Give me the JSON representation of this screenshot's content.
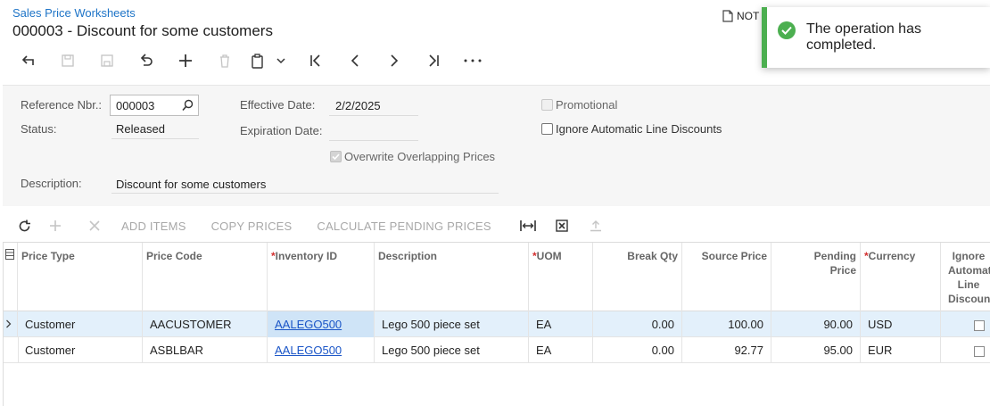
{
  "header": {
    "breadcrumb": "Sales Price Worksheets",
    "title": "000003 - Discount for some customers",
    "notes_label": "NOT"
  },
  "toast": {
    "message": "The operation has completed.",
    "color": "#4caf50"
  },
  "form": {
    "reference_label": "Reference Nbr.:",
    "reference_value": "000003",
    "status_label": "Status:",
    "status_value": "Released",
    "effective_label": "Effective Date:",
    "effective_value": "2/2/2025",
    "expiration_label": "Expiration Date:",
    "expiration_value": "",
    "promotional_label": "Promotional",
    "promotional_checked": false,
    "ignore_auto_label": "Ignore Automatic Line Discounts",
    "ignore_auto_checked": false,
    "overwrite_label": "Overwrite Overlapping Prices",
    "overwrite_checked": true,
    "description_label": "Description:",
    "description_value": "Discount for some customers"
  },
  "grid_toolbar": {
    "add_items": "ADD ITEMS",
    "copy_prices": "COPY PRICES",
    "calculate": "CALCULATE PENDING PRICES"
  },
  "grid": {
    "columns": {
      "price_type": "Price Type",
      "price_code": "Price Code",
      "inventory_id": "Inventory ID",
      "description": "Description",
      "uom": "UOM",
      "break_qty": "Break Qty",
      "source_price": "Source Price",
      "pending_price": "Pending Price",
      "currency": "Currency",
      "ignore_auto": "Ignore Automatic Line Discounts"
    },
    "rows": [
      {
        "price_type": "Customer",
        "price_code": "AACUSTOMER",
        "inventory_id": "AALEGO500",
        "description": "Lego 500 piece set",
        "uom": "EA",
        "break_qty": "0.00",
        "source_price": "100.00",
        "pending_price": "90.00",
        "currency": "USD"
      },
      {
        "price_type": "Customer",
        "price_code": "ASBLBAR",
        "inventory_id": "AALEGO500",
        "description": "Lego 500 piece set",
        "uom": "EA",
        "break_qty": "0.00",
        "source_price": "92.77",
        "pending_price": "95.00",
        "currency": "EUR"
      }
    ]
  }
}
